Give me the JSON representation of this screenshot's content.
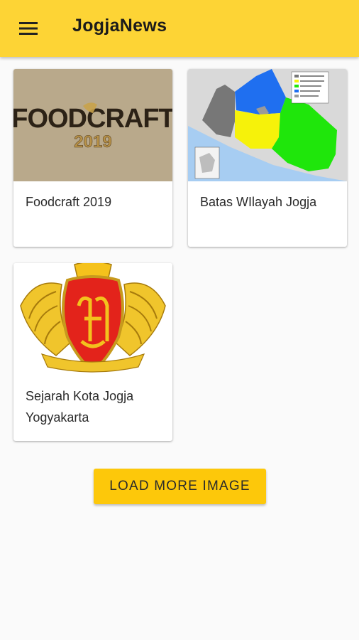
{
  "app": {
    "title": "JogjaNews",
    "menu_icon": "hamburger-menu-icon",
    "bar_color": "#fdd435"
  },
  "cards": [
    {
      "title": "Foodcraft 2019",
      "image": {
        "kind": "logo",
        "text_main": "FOODCRAFT",
        "text_year": "2019"
      }
    },
    {
      "title": "Batas WIlayah Jogja",
      "image": {
        "kind": "map"
      }
    },
    {
      "title": "Sejarah Kota Jogja Yogyakarta",
      "image": {
        "kind": "coat-of-arms"
      }
    }
  ],
  "load_more": {
    "label": "LOAD MORE IMAGE",
    "color": "#fdc80a"
  }
}
